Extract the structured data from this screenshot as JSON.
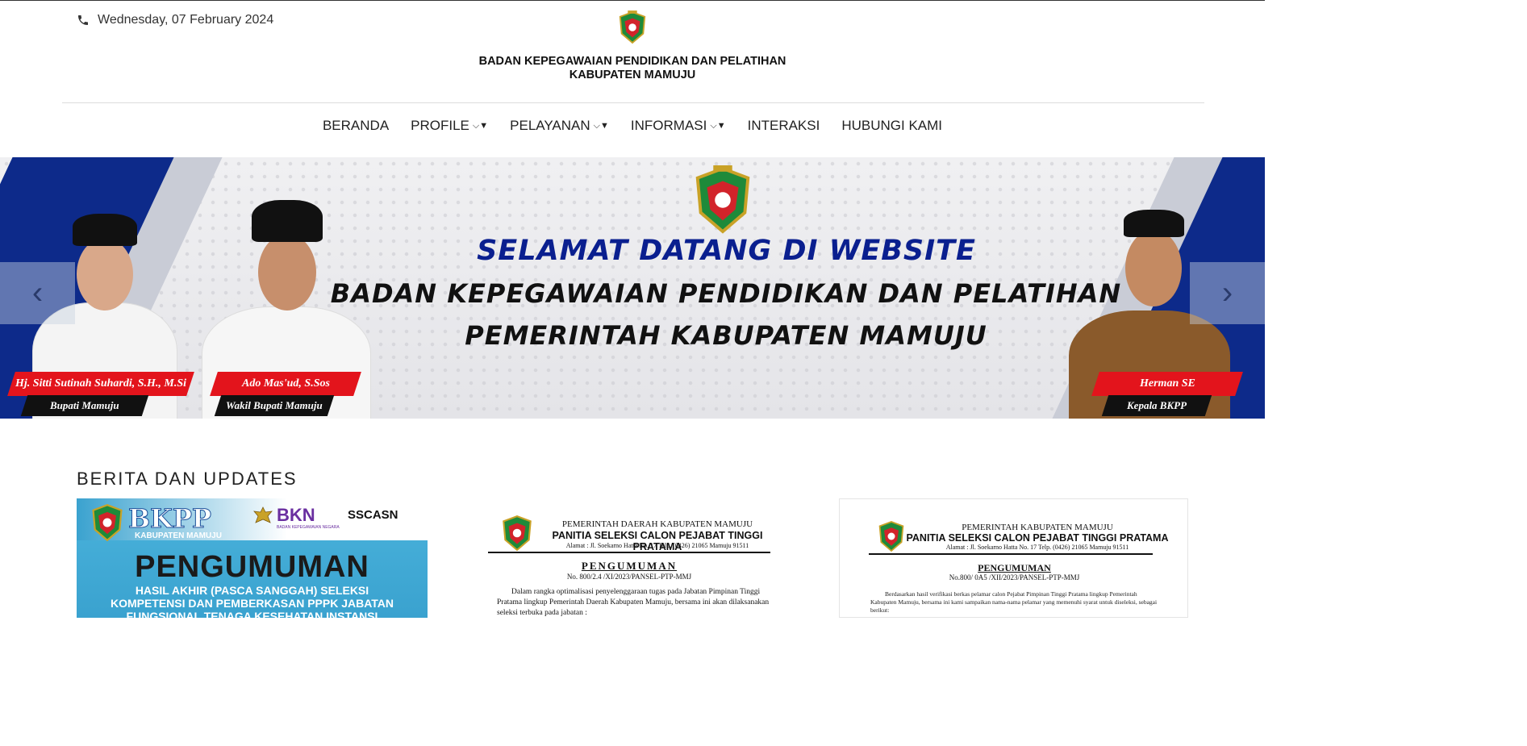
{
  "header": {
    "date": "Wednesday, 07 February 2024",
    "org_title_line1": "BADAN KEPEGAWAIAN PENDIDIKAN DAN PELATIHAN",
    "org_title_line2": "KABUPATEN MAMUJU"
  },
  "nav": {
    "items": [
      {
        "label": "BERANDA",
        "dropdown": false
      },
      {
        "label": "PROFILE",
        "dropdown": true
      },
      {
        "label": "PELAYANAN",
        "dropdown": true
      },
      {
        "label": "INFORMASI",
        "dropdown": true
      },
      {
        "label": "INTERAKSI",
        "dropdown": false
      },
      {
        "label": "HUBUNGI KAMI",
        "dropdown": false
      }
    ]
  },
  "hero": {
    "welcome": "SELAMAT DATANG DI WEBSITE",
    "line1": "BADAN KEPEGAWAIAN PENDIDIKAN DAN PELATIHAN",
    "line2": "PEMERINTAH KABUPATEN MAMUJU",
    "people": [
      {
        "name": "Hj. Sitti Sutinah Suhardi, S.H., M.Si",
        "role": "Bupati Mamuju"
      },
      {
        "name": "Ado Mas'ud, S.Sos",
        "role": "Wakil Bupati Mamuju"
      },
      {
        "name": "Herman SE",
        "role": "Kepala BKPP"
      }
    ],
    "prev_arrow": "‹",
    "next_arrow": "›"
  },
  "news": {
    "section_title": "BERITA DAN UPDATES",
    "card1": {
      "bkpp": "BKPP",
      "kab": "KABUPATEN MAMUJU",
      "bkn": "BKN",
      "bkn_sub": "BADAN KEPEGAWAIAN NEGARA",
      "ssc": "SSCASN",
      "title": "PENGUMUMAN",
      "line1": "HASIL AKHIR (PASCA SANGGAH) SELEKSI",
      "line2": "KOMPETENSI DAN PEMBERKASAN  PPPK JABATAN",
      "line3": "FUNGSIONAL TENAGA KESEHATAN INSTANSI"
    },
    "card2": {
      "h1": "PEMERINTAH DAERAH KABUPATEN MAMUJU",
      "h2": "PANITIA SELEKSI CALON PEJABAT TINGGI PRATAMA",
      "addr": "Alamat : Jl. Soekarno Hatta No. 17 Telp. (0426) 21065 Mamuju 91511",
      "title": "PENGUMUMAN",
      "number": "No. 800/2.4 /XI/2023/PANSEL-PTP-MMJ",
      "body": "Dalam rangka optimalisasi penyelenggaraan tugas pada Jabatan Pimpinan Tinggi Pratama lingkup Pemerintah Daerah Kabupaten Mamuju, bersama ini akan dilaksanakan seleksi terbuka pada jabatan :"
    },
    "card3": {
      "h1": "PEMERINTAH KABUPATEN MAMUJU",
      "h2": "PANITIA SELEKSI CALON PEJABAT TINGGI PRATAMA",
      "addr": "Alamat : Jl. Soekarno Hatta No. 17 Telp. (0426) 21065 Mamuju 91511",
      "title": "PENGUMUMAN",
      "number": "No.800/  0A5 /XII/2023/PANSEL-PTP-MMJ",
      "body": "Berdasarkan hasil verifikasi berkas pelamar calon Pejabat Pimpinan Tinggi Pratama lingkup Pemerintah Kabupaten Mamuju, bersama ini kami sampaikan nama-nama pelamar yang memenuhi syarat untuk diseleksi, sebagai berikut:"
    }
  },
  "colors": {
    "navy": "#0a1f8f",
    "red_tag": "#e3141c",
    "card_blue": "#3aa2cf"
  }
}
